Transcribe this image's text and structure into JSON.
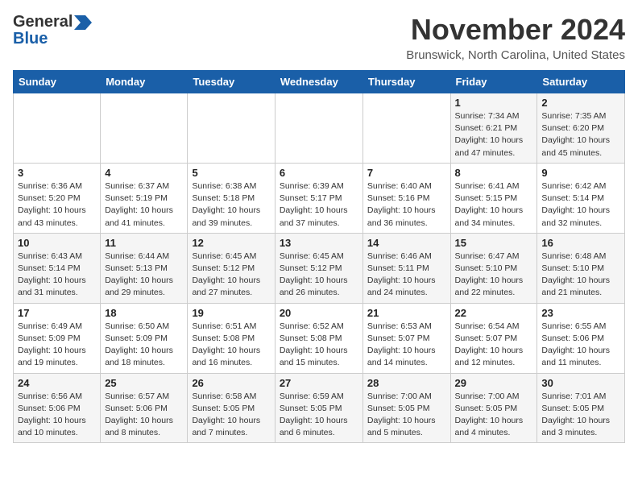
{
  "logo": {
    "line1": "General",
    "line2": "Blue",
    "arrow": "▶"
  },
  "title": "November 2024",
  "subtitle": "Brunswick, North Carolina, United States",
  "days_of_week": [
    "Sunday",
    "Monday",
    "Tuesday",
    "Wednesday",
    "Thursday",
    "Friday",
    "Saturday"
  ],
  "weeks": [
    [
      {
        "day": "",
        "info": ""
      },
      {
        "day": "",
        "info": ""
      },
      {
        "day": "",
        "info": ""
      },
      {
        "day": "",
        "info": ""
      },
      {
        "day": "",
        "info": ""
      },
      {
        "day": "1",
        "info": "Sunrise: 7:34 AM\nSunset: 6:21 PM\nDaylight: 10 hours\nand 47 minutes."
      },
      {
        "day": "2",
        "info": "Sunrise: 7:35 AM\nSunset: 6:20 PM\nDaylight: 10 hours\nand 45 minutes."
      }
    ],
    [
      {
        "day": "3",
        "info": "Sunrise: 6:36 AM\nSunset: 5:20 PM\nDaylight: 10 hours\nand 43 minutes."
      },
      {
        "day": "4",
        "info": "Sunrise: 6:37 AM\nSunset: 5:19 PM\nDaylight: 10 hours\nand 41 minutes."
      },
      {
        "day": "5",
        "info": "Sunrise: 6:38 AM\nSunset: 5:18 PM\nDaylight: 10 hours\nand 39 minutes."
      },
      {
        "day": "6",
        "info": "Sunrise: 6:39 AM\nSunset: 5:17 PM\nDaylight: 10 hours\nand 37 minutes."
      },
      {
        "day": "7",
        "info": "Sunrise: 6:40 AM\nSunset: 5:16 PM\nDaylight: 10 hours\nand 36 minutes."
      },
      {
        "day": "8",
        "info": "Sunrise: 6:41 AM\nSunset: 5:15 PM\nDaylight: 10 hours\nand 34 minutes."
      },
      {
        "day": "9",
        "info": "Sunrise: 6:42 AM\nSunset: 5:14 PM\nDaylight: 10 hours\nand 32 minutes."
      }
    ],
    [
      {
        "day": "10",
        "info": "Sunrise: 6:43 AM\nSunset: 5:14 PM\nDaylight: 10 hours\nand 31 minutes."
      },
      {
        "day": "11",
        "info": "Sunrise: 6:44 AM\nSunset: 5:13 PM\nDaylight: 10 hours\nand 29 minutes."
      },
      {
        "day": "12",
        "info": "Sunrise: 6:45 AM\nSunset: 5:12 PM\nDaylight: 10 hours\nand 27 minutes."
      },
      {
        "day": "13",
        "info": "Sunrise: 6:45 AM\nSunset: 5:12 PM\nDaylight: 10 hours\nand 26 minutes."
      },
      {
        "day": "14",
        "info": "Sunrise: 6:46 AM\nSunset: 5:11 PM\nDaylight: 10 hours\nand 24 minutes."
      },
      {
        "day": "15",
        "info": "Sunrise: 6:47 AM\nSunset: 5:10 PM\nDaylight: 10 hours\nand 22 minutes."
      },
      {
        "day": "16",
        "info": "Sunrise: 6:48 AM\nSunset: 5:10 PM\nDaylight: 10 hours\nand 21 minutes."
      }
    ],
    [
      {
        "day": "17",
        "info": "Sunrise: 6:49 AM\nSunset: 5:09 PM\nDaylight: 10 hours\nand 19 minutes."
      },
      {
        "day": "18",
        "info": "Sunrise: 6:50 AM\nSunset: 5:09 PM\nDaylight: 10 hours\nand 18 minutes."
      },
      {
        "day": "19",
        "info": "Sunrise: 6:51 AM\nSunset: 5:08 PM\nDaylight: 10 hours\nand 16 minutes."
      },
      {
        "day": "20",
        "info": "Sunrise: 6:52 AM\nSunset: 5:08 PM\nDaylight: 10 hours\nand 15 minutes."
      },
      {
        "day": "21",
        "info": "Sunrise: 6:53 AM\nSunset: 5:07 PM\nDaylight: 10 hours\nand 14 minutes."
      },
      {
        "day": "22",
        "info": "Sunrise: 6:54 AM\nSunset: 5:07 PM\nDaylight: 10 hours\nand 12 minutes."
      },
      {
        "day": "23",
        "info": "Sunrise: 6:55 AM\nSunset: 5:06 PM\nDaylight: 10 hours\nand 11 minutes."
      }
    ],
    [
      {
        "day": "24",
        "info": "Sunrise: 6:56 AM\nSunset: 5:06 PM\nDaylight: 10 hours\nand 10 minutes."
      },
      {
        "day": "25",
        "info": "Sunrise: 6:57 AM\nSunset: 5:06 PM\nDaylight: 10 hours\nand 8 minutes."
      },
      {
        "day": "26",
        "info": "Sunrise: 6:58 AM\nSunset: 5:05 PM\nDaylight: 10 hours\nand 7 minutes."
      },
      {
        "day": "27",
        "info": "Sunrise: 6:59 AM\nSunset: 5:05 PM\nDaylight: 10 hours\nand 6 minutes."
      },
      {
        "day": "28",
        "info": "Sunrise: 7:00 AM\nSunset: 5:05 PM\nDaylight: 10 hours\nand 5 minutes."
      },
      {
        "day": "29",
        "info": "Sunrise: 7:00 AM\nSunset: 5:05 PM\nDaylight: 10 hours\nand 4 minutes."
      },
      {
        "day": "30",
        "info": "Sunrise: 7:01 AM\nSunset: 5:05 PM\nDaylight: 10 hours\nand 3 minutes."
      }
    ]
  ]
}
